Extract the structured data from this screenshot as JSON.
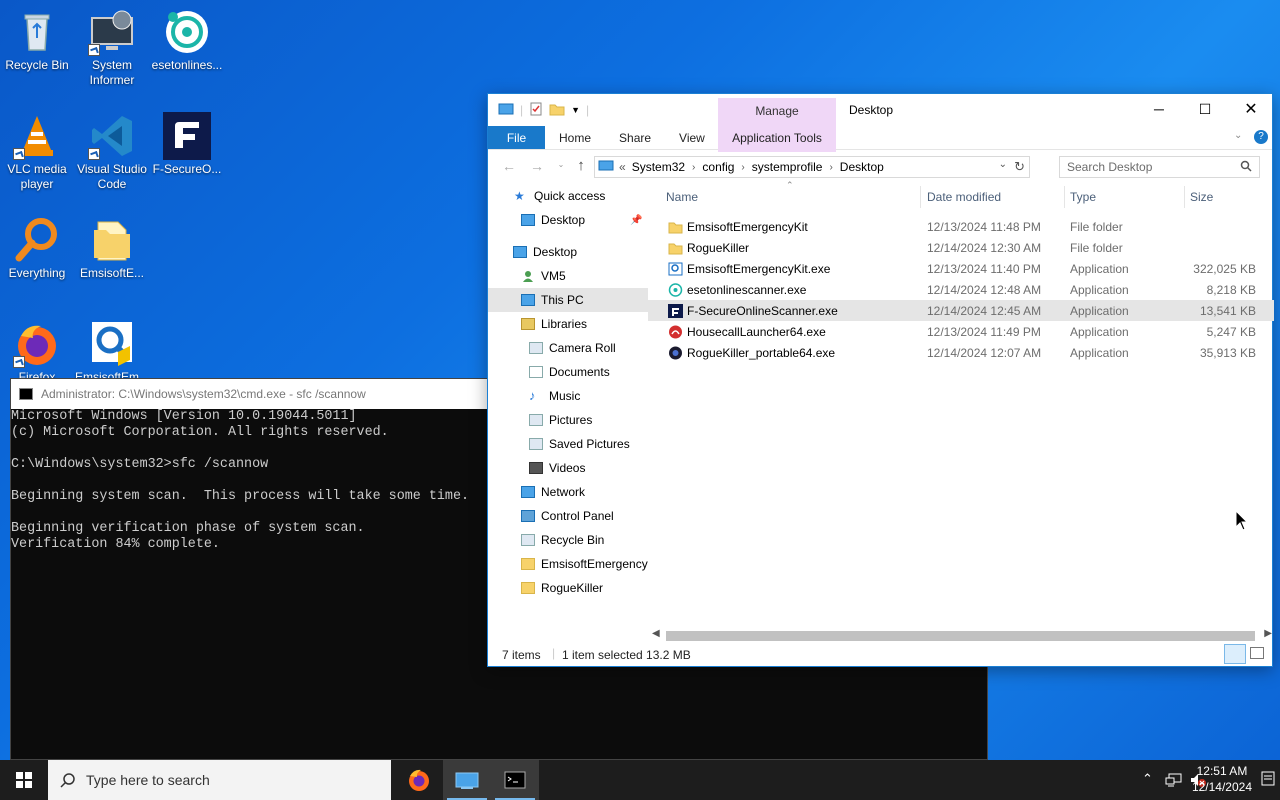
{
  "desktop": {
    "icons": [
      {
        "label": "Recycle Bin"
      },
      {
        "label": "System Informer"
      },
      {
        "label": "esetonlines..."
      },
      {
        "label": "VLC media player"
      },
      {
        "label": "Visual Studio Code"
      },
      {
        "label": "F-SecureO..."
      },
      {
        "label": "Everything"
      },
      {
        "label": "EmsisoftE..."
      },
      {
        "label": "Firefox"
      },
      {
        "label": "EmsisoftEm..."
      }
    ]
  },
  "cmd": {
    "title": "Administrator: C:\\Windows\\system32\\cmd.exe - sfc  /scannow",
    "lines": [
      "Microsoft Windows [Version 10.0.19044.5011]",
      "(c) Microsoft Corporation. All rights reserved.",
      "",
      "C:\\Windows\\system32>sfc /scannow",
      "",
      "Beginning system scan.  This process will take some time.",
      "",
      "Beginning verification phase of system scan.",
      "Verification 84% complete."
    ]
  },
  "explorer": {
    "title": "Desktop",
    "manage_tab": "Manage",
    "ribbon_tabs": {
      "file": "File",
      "home": "Home",
      "share": "Share",
      "view": "View",
      "app_tools": "Application Tools"
    },
    "address": [
      "System32",
      "config",
      "systemprofile",
      "Desktop"
    ],
    "address_prefix": "«",
    "search_placeholder": "Search Desktop",
    "nav": {
      "quick_access": "Quick access",
      "qa_desktop": "Desktop",
      "desktop": "Desktop",
      "vm5": "VM5",
      "this_pc": "This PC",
      "libraries": "Libraries",
      "camera_roll": "Camera Roll",
      "documents": "Documents",
      "music": "Music",
      "pictures": "Pictures",
      "saved_pictures": "Saved Pictures",
      "videos": "Videos",
      "network": "Network",
      "control_panel": "Control Panel",
      "recycle_bin": "Recycle Bin",
      "emsisoft": "EmsisoftEmergency",
      "roguekiller": "RogueKiller"
    },
    "columns": {
      "name": "Name",
      "date": "Date modified",
      "type": "Type",
      "size": "Size"
    },
    "files": [
      {
        "name": "EmsisoftEmergencyKit",
        "date": "12/13/2024 11:48 PM",
        "type": "File folder",
        "size": "",
        "icon": "folder-icon"
      },
      {
        "name": "RogueKiller",
        "date": "12/14/2024 12:30 AM",
        "type": "File folder",
        "size": "",
        "icon": "folder-icon"
      },
      {
        "name": "EmsisoftEmergencyKit.exe",
        "date": "12/13/2024 11:40 PM",
        "type": "Application",
        "size": "322,025 KB",
        "icon": "emsisoft-app-icon"
      },
      {
        "name": "esetonlinescanner.exe",
        "date": "12/14/2024 12:48 AM",
        "type": "Application",
        "size": "8,218 KB",
        "icon": "eset-app-icon"
      },
      {
        "name": "F-SecureOnlineScanner.exe",
        "date": "12/14/2024 12:45 AM",
        "type": "Application",
        "size": "13,541 KB",
        "icon": "fsecure-app-icon"
      },
      {
        "name": "HousecallLauncher64.exe",
        "date": "12/13/2024 11:49 PM",
        "type": "Application",
        "size": "5,247 KB",
        "icon": "housecall-app-icon"
      },
      {
        "name": "RogueKiller_portable64.exe",
        "date": "12/14/2024 12:07 AM",
        "type": "Application",
        "size": "35,913 KB",
        "icon": "roguekiller-app-icon"
      }
    ],
    "status": {
      "items": "7 items",
      "selected": "1 item selected  13.2 MB"
    }
  },
  "taskbar": {
    "search_placeholder": "Type here to search",
    "time": "12:51 AM",
    "date": "12/14/2024"
  },
  "colors": {
    "accent": "#1979ca",
    "manage": "#f0d7f7",
    "taskbar": "#1d1d1d",
    "desktop": "#0d6fe0"
  }
}
